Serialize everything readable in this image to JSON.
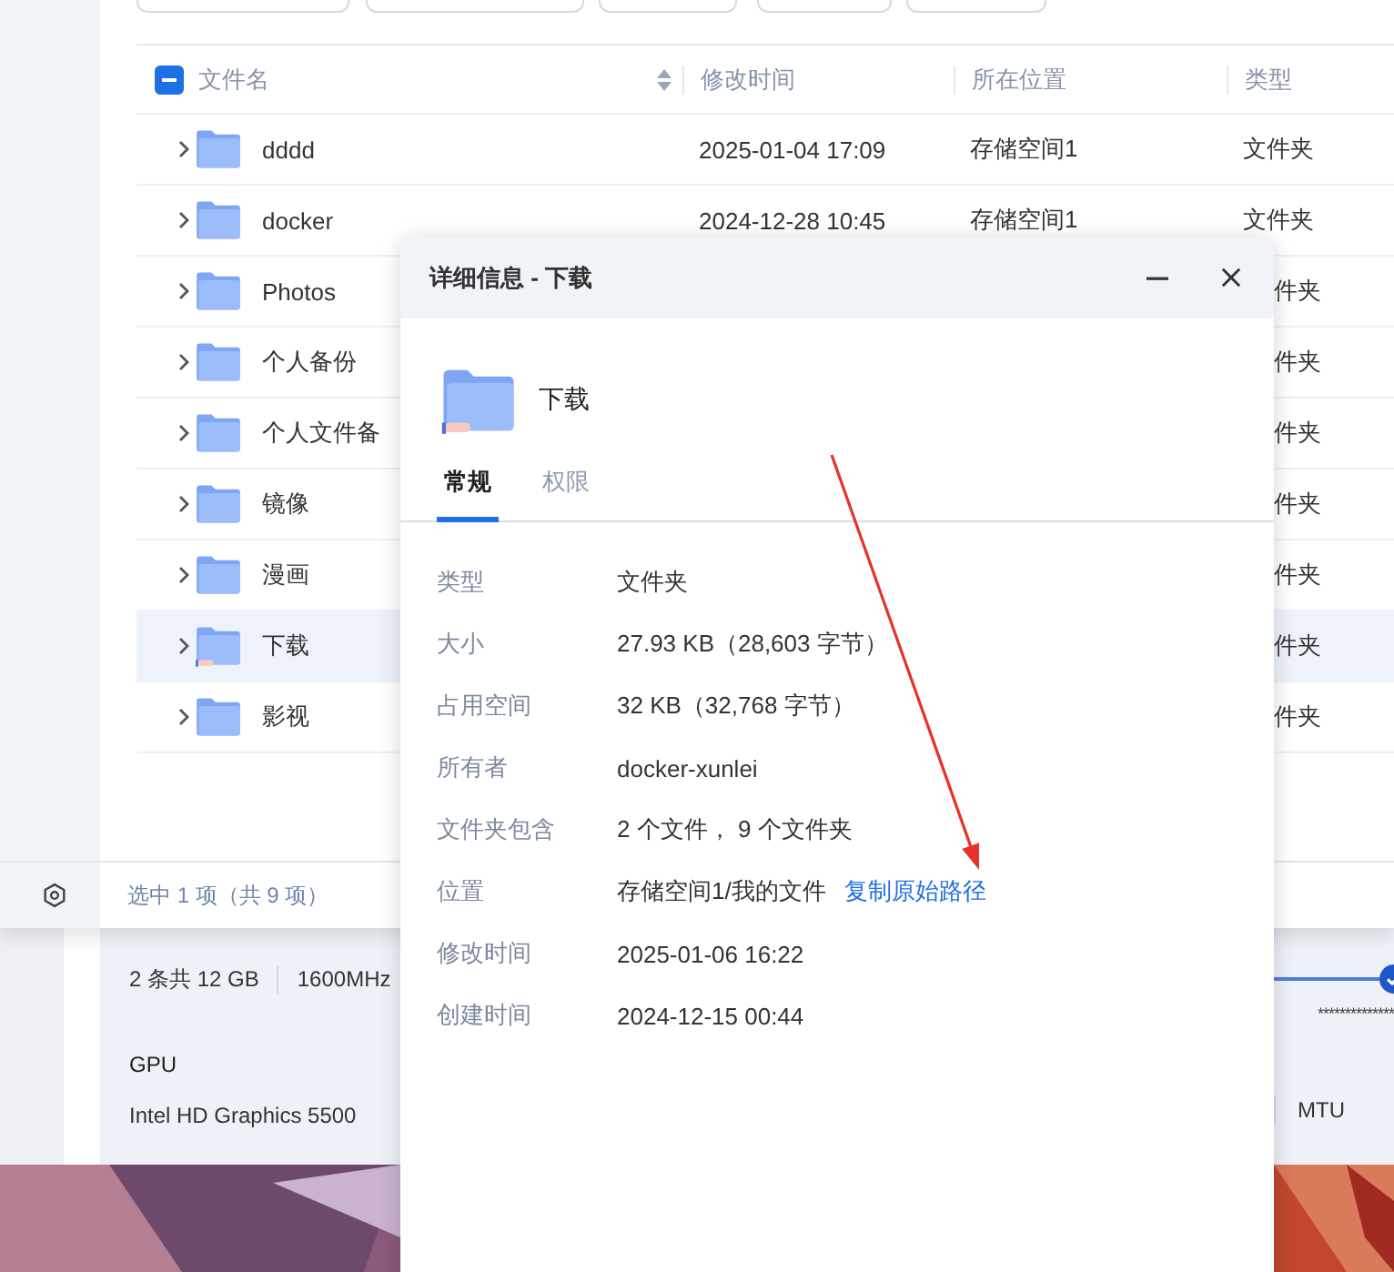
{
  "file_table": {
    "header_checkbox": {
      "indeterminate": true
    },
    "columns": [
      {
        "label": "文件名",
        "sortable": true
      },
      {
        "label": "修改时间",
        "sortable": false
      },
      {
        "label": "所在位置",
        "sortable": false
      },
      {
        "label": "类型",
        "sortable": false
      }
    ],
    "rows": [
      {
        "name": "dddd",
        "modified": "2025-01-04 17:09",
        "location": "存储空间1",
        "type": "文件夹",
        "selected": false,
        "shared": false
      },
      {
        "name": "docker",
        "modified": "2024-12-28 10:45",
        "location": "存储空间1",
        "type": "文件夹",
        "selected": false,
        "shared": false
      },
      {
        "name": "Photos",
        "type": "件夹",
        "selected": false,
        "shared": false
      },
      {
        "name": "个人备份",
        "type": "件夹",
        "selected": false,
        "shared": false
      },
      {
        "name": "个人文件备",
        "type": "件夹",
        "selected": false,
        "shared": false
      },
      {
        "name": "镜像",
        "type": "件夹",
        "selected": false,
        "shared": false
      },
      {
        "name": "漫画",
        "type": "件夹",
        "selected": false,
        "shared": false
      },
      {
        "name": "下载",
        "type": "件夹",
        "selected": true,
        "shared": true
      },
      {
        "name": "影视",
        "type": "件夹",
        "selected": false,
        "shared": false
      }
    ]
  },
  "status_bar": {
    "text": "选中 1 项（共 9 项）"
  },
  "system_info": {
    "memory": "2 条共 12 GB",
    "memory_speed": "1600MHz",
    "gpu_label": "GPU",
    "gpu": "Intel HD Graphics 5500",
    "masked": "**************",
    "mtu_label": "MTU"
  },
  "dialog": {
    "title": "详细信息 - 下载",
    "name": "下载",
    "shared": true,
    "tabs": [
      {
        "label": "常规",
        "selected": true
      },
      {
        "label": "权限",
        "selected": false
      }
    ],
    "fields": [
      {
        "label": "类型",
        "value": "文件夹"
      },
      {
        "label": "大小",
        "value": "27.93 KB（28,603 字节）"
      },
      {
        "label": "占用空间",
        "value": "32 KB（32,768 字节）"
      },
      {
        "label": "所有者",
        "value": "docker-xunlei"
      },
      {
        "label": "文件夹包含",
        "value": "2 个文件， 9 个文件夹"
      },
      {
        "label": "位置",
        "value": "存储空间1/我的文件",
        "link": "复制原始路径"
      },
      {
        "label": "修改时间",
        "value": "2025-01-06 16:22"
      },
      {
        "label": "创建时间",
        "value": "2024-12-15 00:44"
      }
    ]
  }
}
